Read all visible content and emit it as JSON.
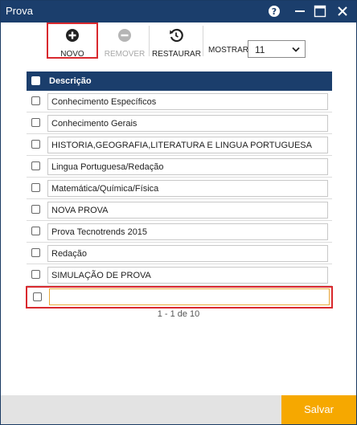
{
  "window": {
    "title": "Prova"
  },
  "toolbar": {
    "novo_label": "NOVO",
    "remover_label": "REMOVER",
    "restaurar_label": "RESTAURAR",
    "mostrar_label": "MOSTRAR:",
    "mostrar_value": "11"
  },
  "grid": {
    "header": "Descrição",
    "rows": [
      "Conhecimento Específicos",
      "Conhecimento Gerais",
      "HISTORIA,GEOGRAFIA,LITERATURA E LINGUA PORTUGUESA",
      "Lingua Portuguesa/Redação",
      "Matemática/Química/Física",
      "NOVA PROVA",
      "Prova Tecnotrends 2015",
      "Redação",
      "SIMULAÇÃO DE PROVA"
    ],
    "new_row_value": ""
  },
  "pager": {
    "text": "1 - 1 de 10"
  },
  "footer": {
    "salvar_label": "Salvar"
  },
  "colors": {
    "titlebar": "#1b3e6c",
    "accent": "#f6a800",
    "highlight": "#d9292e"
  }
}
